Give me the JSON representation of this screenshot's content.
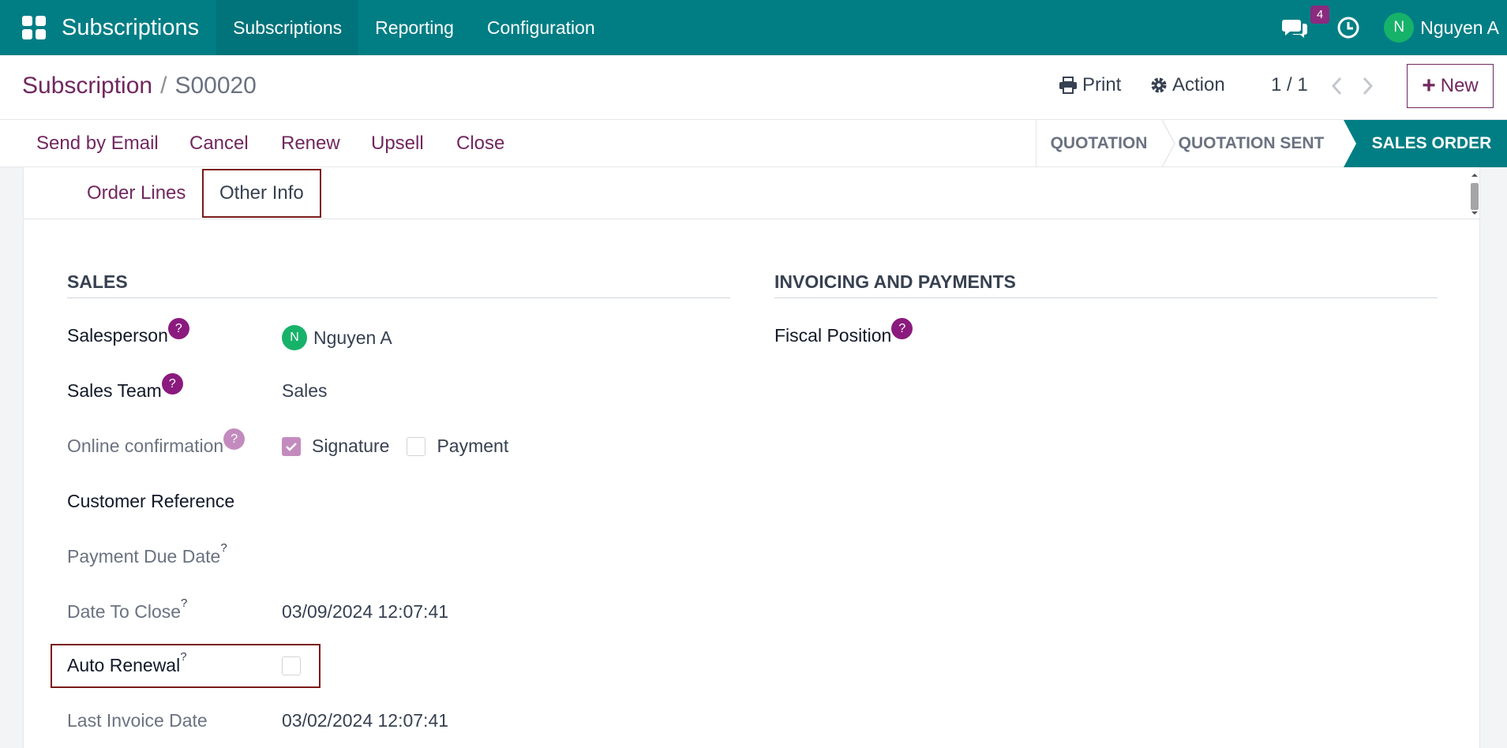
{
  "navbar": {
    "brand": "Subscriptions",
    "menu": [
      "Subscriptions",
      "Reporting",
      "Configuration"
    ],
    "chat_badge": "4",
    "user_initial": "N",
    "user_name": "Nguyen A",
    "bg_color": "#017e84"
  },
  "control": {
    "breadcrumb_parent": "Subscription",
    "breadcrumb_sep": "/",
    "breadcrumb_current": "S00020",
    "print_label": "Print",
    "action_label": "Action",
    "pager": "1 / 1",
    "new_label": "New"
  },
  "statusbar": {
    "actions": [
      "Send by Email",
      "Cancel",
      "Renew",
      "Upsell",
      "Close"
    ],
    "stages": [
      "QUOTATION",
      "QUOTATION SENT",
      "SALES ORDER"
    ],
    "active_stage": "SALES ORDER"
  },
  "tabs": {
    "order_lines": "Order Lines",
    "other_info": "Other Info",
    "active": "Other Info"
  },
  "sales": {
    "title": "SALES",
    "salesperson_label": "Salesperson",
    "salesperson_initial": "N",
    "salesperson_value": "Nguyen A",
    "sales_team_label": "Sales Team",
    "sales_team_value": "Sales",
    "online_confirmation_label": "Online confirmation",
    "signature_label": "Signature",
    "signature_checked": true,
    "payment_label": "Payment",
    "payment_checked": false,
    "customer_reference_label": "Customer Reference",
    "payment_due_date_label": "Payment Due Date",
    "date_to_close_label": "Date To Close",
    "date_to_close_value": "03/09/2024 12:07:41",
    "auto_renewal_label": "Auto Renewal",
    "auto_renewal_checked": false,
    "last_invoice_date_label": "Last Invoice Date",
    "last_invoice_date_value": "03/02/2024 12:07:41"
  },
  "invoicing": {
    "title": "INVOICING AND PAYMENTS",
    "fiscal_position_label": "Fiscal Position"
  },
  "help_glyph": "?",
  "icons": [
    "apps-grid-icon",
    "chat-icon",
    "clock-icon",
    "print-icon",
    "gear-icon",
    "chevron-left-icon",
    "chevron-right-icon",
    "plus-icon",
    "check-icon"
  ]
}
